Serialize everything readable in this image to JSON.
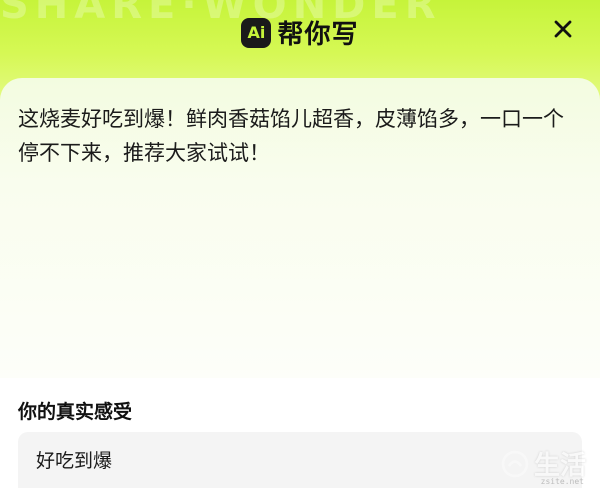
{
  "header": {
    "badge": "Ai",
    "title": "帮你写",
    "watermark_text": "SHARE·WONDER",
    "close_label": "close"
  },
  "generated": {
    "text": "这烧麦好吃到爆！鲜肉香菇馅儿超香，皮薄馅多，一口一个停不下来，推荐大家试试！"
  },
  "feeling": {
    "label": "你的真实感受",
    "value": "好吃到爆"
  },
  "brand": {
    "name": "生活",
    "url": "zsite.net"
  },
  "colors": {
    "accent": "#c6f43a",
    "card_top": "#f3fce0",
    "text": "#1b1b1b",
    "input_bg": "#f4f4f4"
  }
}
